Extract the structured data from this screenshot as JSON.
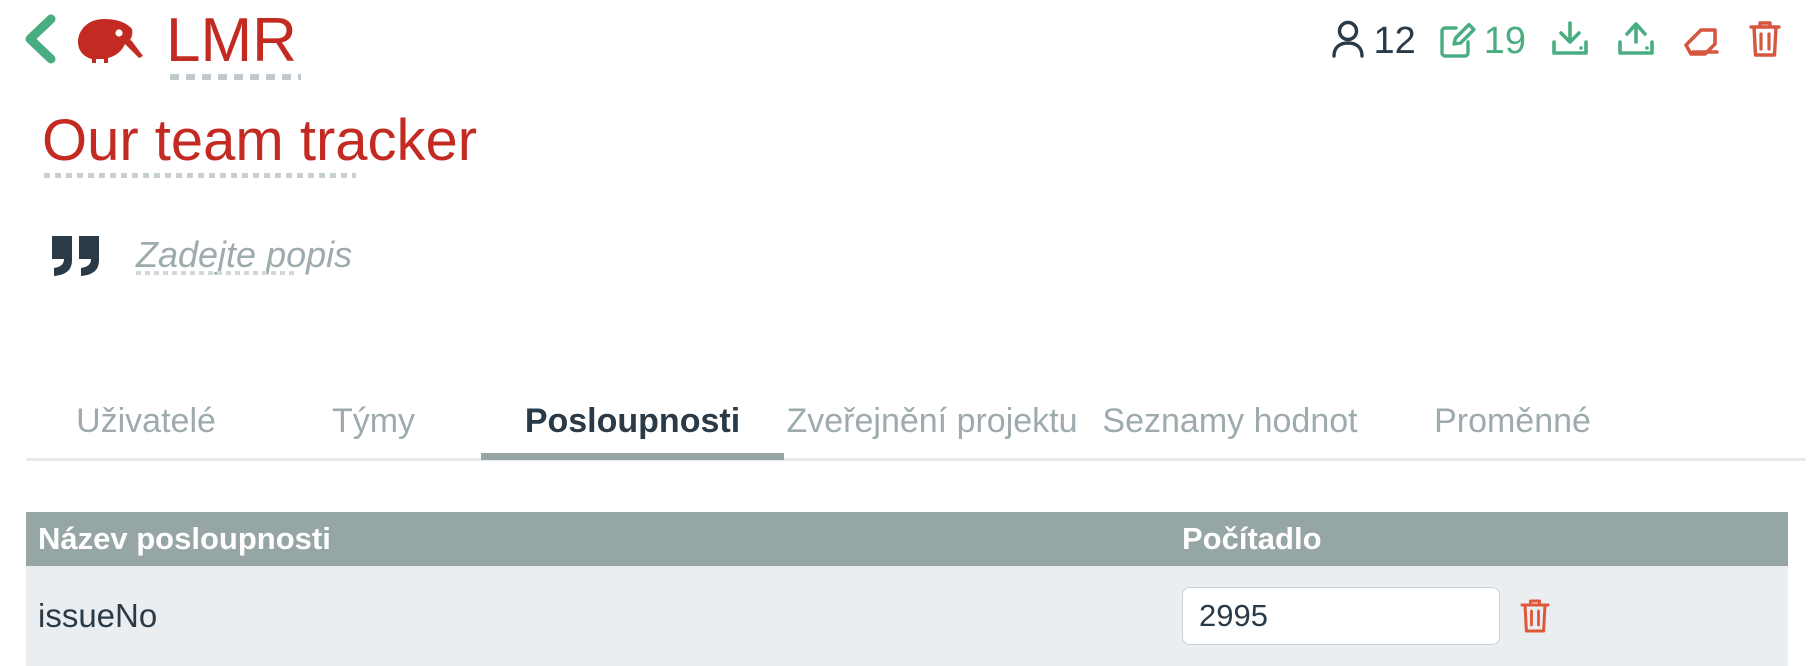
{
  "header": {
    "back_icon": "chevron-left-icon",
    "logo_icon": "kiwi-bird-logo",
    "brand_name": "LMR",
    "actions": {
      "users": {
        "icon": "user-icon",
        "count": "12"
      },
      "edits": {
        "icon": "edit-square-icon",
        "count": "19"
      },
      "import": {
        "icon": "download-tray-icon"
      },
      "export": {
        "icon": "upload-tray-icon"
      },
      "clear": {
        "icon": "eraser-icon"
      },
      "delete": {
        "icon": "trash-icon"
      }
    }
  },
  "project": {
    "title": "Our team tracker",
    "description_placeholder": "Zadejte popis",
    "quote_icon": "quote-marks-icon"
  },
  "tabs": [
    {
      "label": "Uživatelé",
      "active": false
    },
    {
      "label": "Týmy",
      "active": false
    },
    {
      "label": "Posloupnosti",
      "active": true
    },
    {
      "label": "Zveřejnění projektu",
      "active": false
    },
    {
      "label": "Seznamy hodnot",
      "active": false
    },
    {
      "label": "Proměnné",
      "active": false
    }
  ],
  "table": {
    "columns": [
      "Název posloupnosti",
      "Počítadlo"
    ],
    "rows": [
      {
        "name": "issueNo",
        "counter": "2995",
        "delete_icon": "trash-icon"
      }
    ]
  },
  "colors": {
    "brand_red": "#c32b22",
    "accent_green": "#49ad81",
    "dark_navy": "#2b3a47",
    "muted_gray": "#9daaae",
    "header_gray": "#96a6a5",
    "row_bg": "#eaeef0"
  }
}
